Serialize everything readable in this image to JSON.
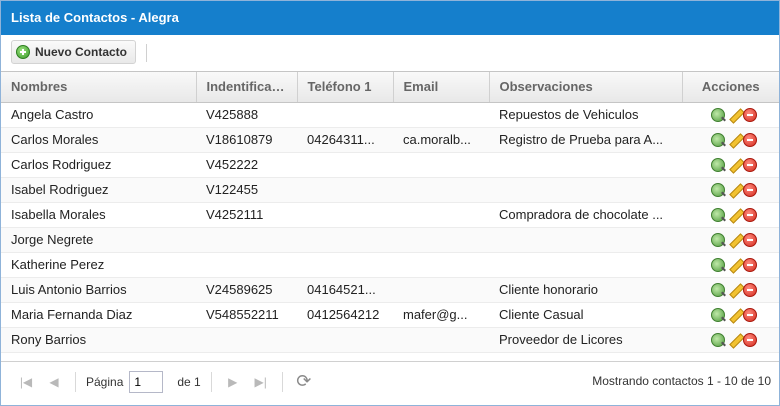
{
  "window": {
    "title": "Lista de Contactos - Alegra"
  },
  "toolbar": {
    "new_contact_label": "Nuevo Contacto"
  },
  "table": {
    "columns": [
      "Nombres",
      "Indentificación",
      "Teléfono 1",
      "Email",
      "Observaciones",
      "Acciones"
    ],
    "rows": [
      [
        "Angela Castro",
        "V425888",
        "",
        "",
        "Repuestos de Vehiculos"
      ],
      [
        "Carlos Morales",
        "V18610879",
        "04264311...",
        "ca.moralb...",
        "Registro de Prueba para A..."
      ],
      [
        "Carlos Rodriguez",
        "V452222",
        "",
        "",
        ""
      ],
      [
        "Isabel Rodriguez",
        "V122455",
        "",
        "",
        ""
      ],
      [
        "Isabella Morales",
        "V4252111",
        "",
        "",
        "Compradora de chocolate ..."
      ],
      [
        "Jorge Negrete",
        "",
        "",
        "",
        ""
      ],
      [
        "Katherine Perez",
        "",
        "",
        "",
        ""
      ],
      [
        "Luis Antonio Barrios",
        "V24589625",
        "04164521...",
        "",
        "Cliente honorario"
      ],
      [
        "Maria Fernanda Diaz",
        "V548552211",
        "0412564212",
        "mafer@g...",
        "Cliente Casual"
      ],
      [
        "Rony Barrios",
        "",
        "",
        "",
        "Proveedor de Licores"
      ]
    ],
    "action_icons": [
      "view-icon",
      "edit-icon",
      "delete-icon"
    ]
  },
  "pager": {
    "page_label": "Página",
    "page_value": "1",
    "of_label": "de 1",
    "status": "Mostrando contactos 1 - 10 de 10"
  }
}
